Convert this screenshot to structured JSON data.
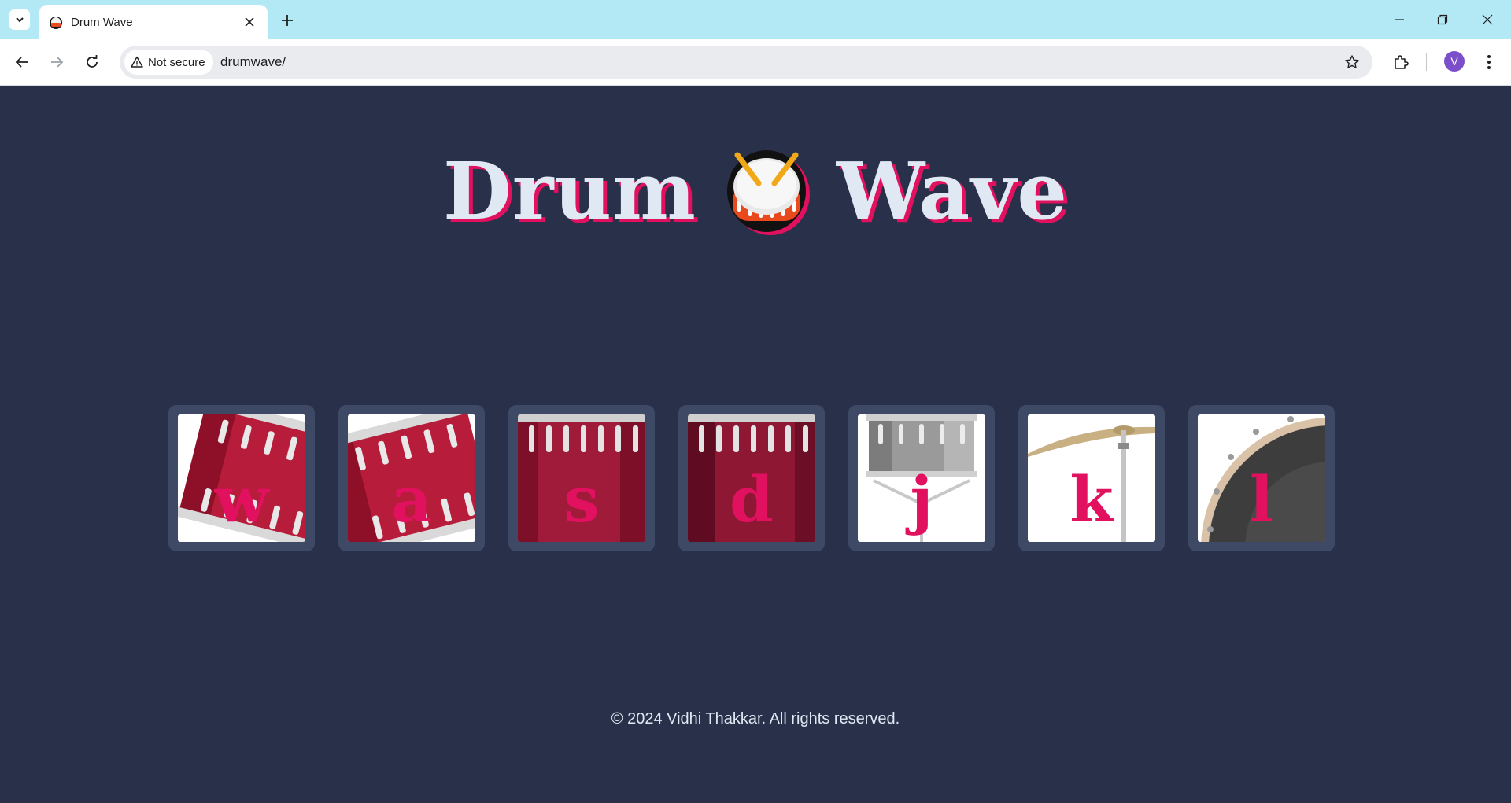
{
  "browser": {
    "tab_title": "Drum Wave",
    "security_label": "Not secure",
    "url": "drumwave/",
    "profile_initial": "V"
  },
  "page": {
    "title_left": "Drum",
    "title_right": "Wave",
    "title_icon": "drum-emoji-icon",
    "pads": [
      {
        "key": "w",
        "image": "tom-drum"
      },
      {
        "key": "a",
        "image": "tom-drum"
      },
      {
        "key": "s",
        "image": "snare-drum"
      },
      {
        "key": "d",
        "image": "snare-drum"
      },
      {
        "key": "j",
        "image": "silver-snare"
      },
      {
        "key": "k",
        "image": "cymbal"
      },
      {
        "key": "l",
        "image": "bass-drum"
      }
    ],
    "footer": "© 2024 Vidhi Thakkar. All rights reserved."
  },
  "colors": {
    "background": "#283149",
    "pad_frame": "#3e4966",
    "accent": "#e1115f",
    "title_text": "#dfe8f3"
  }
}
